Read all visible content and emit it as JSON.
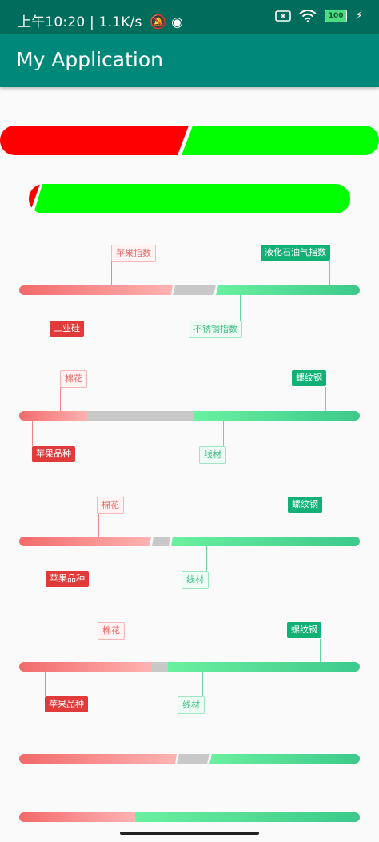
{
  "status_bar": {
    "time": "上午10:20",
    "speed": "1.1K/s",
    "battery": "100"
  },
  "app_bar": {
    "title": "My Application"
  },
  "colors": {
    "primary": "#00897b",
    "status_bar": "#006c5b",
    "red": "#ff0000",
    "green": "#00ff00"
  },
  "big_bars": [
    {
      "red_fraction": 0.5
    },
    {
      "red_fraction": 0.01
    }
  ],
  "indicators": [
    {
      "labels": {
        "top_left": "苹果指数",
        "top_right": "液化石油气指数",
        "bottom_left": "工业硅",
        "bottom_right": "不锈钢指数"
      }
    },
    {
      "labels": {
        "top_left": "棉花",
        "top_right": "螺纹钢",
        "bottom_left": "苹果品种",
        "bottom_right": "线材"
      }
    },
    {
      "labels": {
        "top_left": "棉花",
        "top_right": "螺纹钢",
        "bottom_left": "苹果品种",
        "bottom_right": "线材"
      }
    },
    {
      "labels": {
        "top_left": "棉花",
        "top_right": "螺纹钢",
        "bottom_left": "苹果品种",
        "bottom_right": "线材"
      }
    },
    {
      "labels": {}
    },
    {
      "labels": {}
    }
  ]
}
